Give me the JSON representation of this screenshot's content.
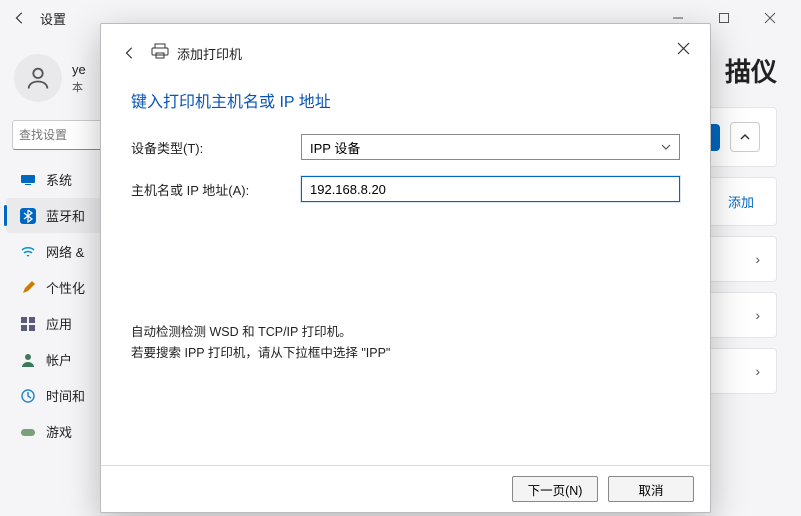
{
  "titlebar": {
    "title": "设置"
  },
  "user": {
    "name": "ye",
    "subtitle": "本"
  },
  "search": {
    "placeholder": "查找设置"
  },
  "sidebar": {
    "items": [
      {
        "label": "系统",
        "icon": "monitor"
      },
      {
        "label": "蓝牙和",
        "icon": "bluetooth",
        "active": true
      },
      {
        "label": "网络 &",
        "icon": "wifi"
      },
      {
        "label": "个性化",
        "icon": "brush"
      },
      {
        "label": "应用",
        "icon": "apps"
      },
      {
        "label": "帐户",
        "icon": "person"
      },
      {
        "label": "时间和",
        "icon": "clock"
      },
      {
        "label": "游戏",
        "icon": "game"
      }
    ]
  },
  "main": {
    "title_fragment": "描仪",
    "add_link": "添加"
  },
  "modal": {
    "breadcrumb": "添加打印机",
    "title": "键入打印机主机名或 IP 地址",
    "device_type_label": "设备类型(T):",
    "device_type_value": "IPP 设备",
    "hostname_label": "主机名或 IP 地址(A):",
    "hostname_value": "192.168.8.20",
    "hint_line1": "自动检测检测 WSD 和 TCP/IP 打印机。",
    "hint_line2": "若要搜索 IPP 打印机，请从下拉框中选择 \"IPP\"",
    "next_btn": "下一页(N)",
    "cancel_btn": "取消"
  }
}
